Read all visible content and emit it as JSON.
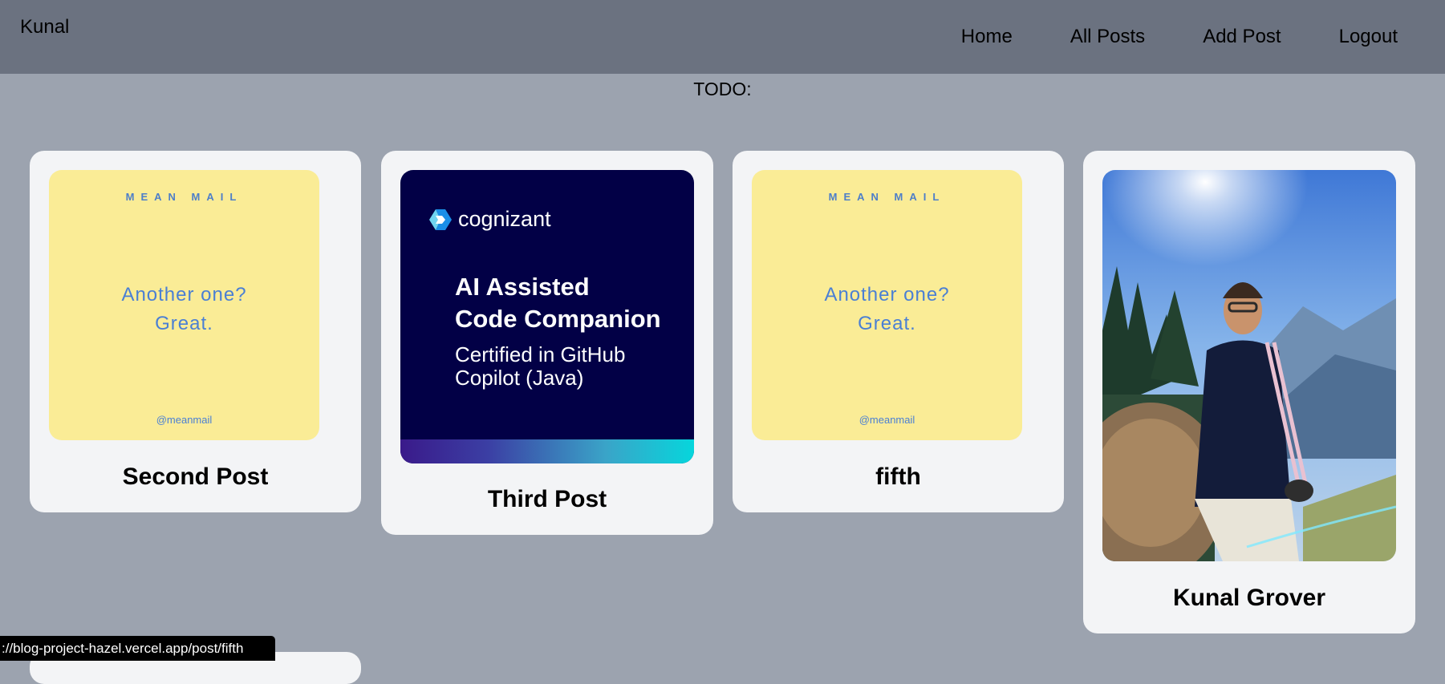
{
  "header": {
    "brand": "Kunal",
    "nav": [
      "Home",
      "All Posts",
      "Add Post",
      "Logout"
    ]
  },
  "todo_label": "TODO:",
  "posts": [
    {
      "title": "Second Post",
      "image": {
        "kind": "mean-mail",
        "logo": "MEAN MAIL",
        "line1": "Another one?",
        "line2": "Great.",
        "handle": "@meanmail"
      }
    },
    {
      "title": "Third Post",
      "image": {
        "kind": "cognizant",
        "brand": "cognizant",
        "heading1": "AI Assisted",
        "heading2": "Code Companion",
        "sub1": "Certified in GitHub",
        "sub2": "Copilot (Java)"
      }
    },
    {
      "title": "fifth",
      "image": {
        "kind": "mean-mail",
        "logo": "MEAN MAIL",
        "line1": "Another one?",
        "line2": "Great.",
        "handle": "@meanmail"
      }
    },
    {
      "title": "Kunal Grover",
      "image": {
        "kind": "photo"
      }
    }
  ],
  "status_url": "://blog-project-hazel.vercel.app/post/fifth",
  "colors": {
    "header_bg": "#6b7280",
    "page_bg": "#9ca3af",
    "card_bg": "#f3f4f6",
    "meanmail_bg": "#faec96",
    "meanmail_text": "#4a7fd4",
    "cognizant_bg": "#020046"
  }
}
